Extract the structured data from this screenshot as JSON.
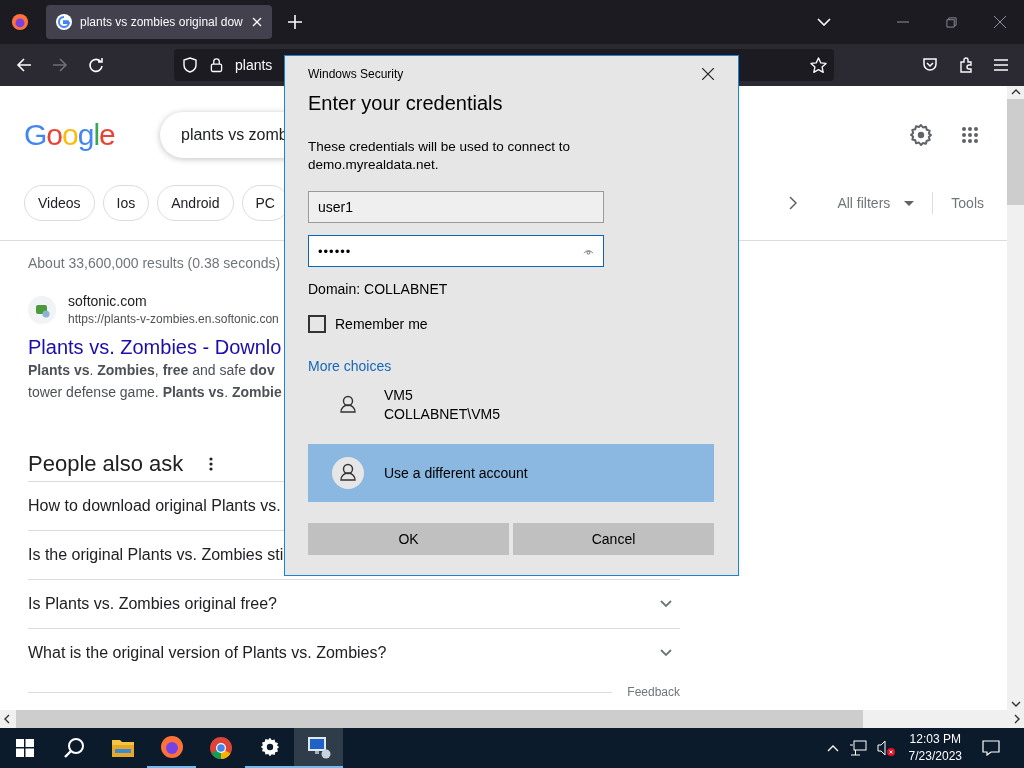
{
  "browser": {
    "tab": {
      "title": "plants vs zombies original dow",
      "selected": true
    },
    "address": "plants"
  },
  "google": {
    "logo": "Google",
    "query": "plants vs zomb",
    "chips": [
      {
        "label": "Videos"
      },
      {
        "label": "Ios"
      },
      {
        "label": "Android"
      },
      {
        "label": "PC"
      }
    ],
    "all_filters": "All filters",
    "tools": "Tools"
  },
  "stats": "About 33,600,000 results (0.38 seconds)",
  "result": {
    "site": "softonic.com",
    "url": "https://plants-v-zombies.en.softonic.con",
    "title": "Plants vs. Zombies - Downlo",
    "snippet": [
      "**Plants vs**. **Zombies**, **free** and safe **dov**",
      "tower defense game. **Plants vs**. **Zombie**"
    ]
  },
  "people_also_ask": {
    "title": "People also ask",
    "questions": [
      {
        "text": "How to download original Plants vs."
      },
      {
        "text": "Is the original Plants vs. Zombies sti"
      },
      {
        "text": "Is Plants vs. Zombies original free?",
        "expanded": false
      },
      {
        "text": "What is the original version of Plants vs. Zombies?",
        "expanded": false
      }
    ],
    "feedback": "Feedback"
  },
  "dialog": {
    "caption": "Windows Security",
    "heading": "Enter your credentials",
    "message": "These credentials will be used to connect to demo.myrealdata.net.",
    "username": "user1",
    "password_dots": "••••••",
    "domain": "Domain: COLLABNET",
    "remember": {
      "label": "Remember me",
      "checked": false
    },
    "more_choices": "More choices",
    "accounts": [
      {
        "name": "VM5",
        "detail": "COLLABNET\\VM5",
        "selected": false
      },
      {
        "name": "Use a different account",
        "selected": true
      }
    ],
    "buttons": [
      "OK",
      "Cancel"
    ]
  },
  "taskbar": {
    "apps": [
      {
        "kind": "start"
      },
      {
        "kind": "search"
      },
      {
        "kind": "folder",
        "running": false
      },
      {
        "kind": "firefox",
        "running": true
      },
      {
        "kind": "chrome",
        "running": false
      },
      {
        "kind": "settings",
        "running": true
      },
      {
        "kind": "remote",
        "running": true
      }
    ],
    "time": "12:03 PM",
    "date": "7/23/2023"
  }
}
